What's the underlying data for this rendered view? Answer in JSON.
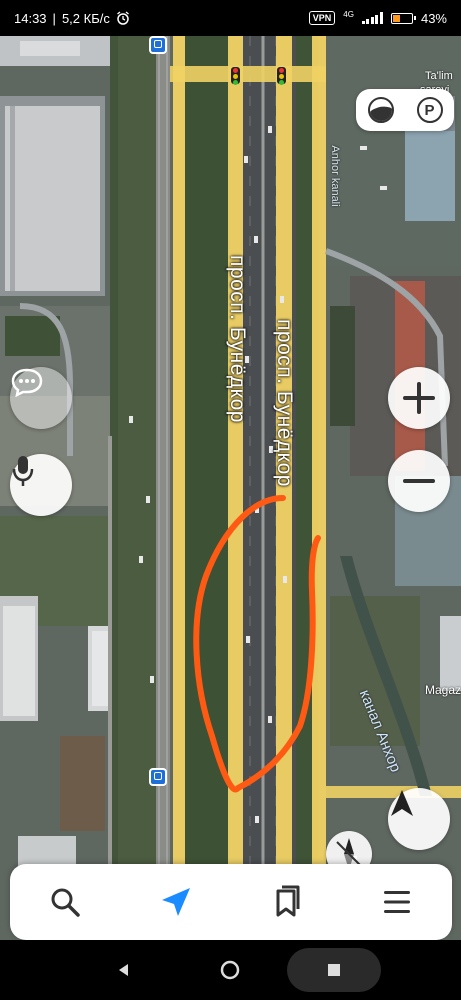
{
  "status_bar": {
    "time": "14:33",
    "network_speed": "5,2 КБ/с",
    "vpn": "VPN",
    "network_type": "4G",
    "battery": "43%",
    "battery_fraction": 0.43
  },
  "map": {
    "street_labels": [
      "просп. Бунёдкор",
      "просп. Бунёдкор"
    ],
    "canal_label": "канал Анхор",
    "canal_label_uz": "Anhor kanali",
    "shop_label": "Magaz",
    "poi_label": "saroyi",
    "poi_label_top": "Ta'lim",
    "annotation_color": "#ff5a14",
    "road_color": "#f0d264",
    "transit_color": "#1f6fd8"
  },
  "controls": {
    "layers": "layers-icon",
    "parking": "P",
    "zoom_in": "plus-icon",
    "zoom_out": "minus-icon",
    "voice": "microphone-icon",
    "chat": "chat-icon",
    "compass": "compass-icon",
    "location": "location-arrow-icon"
  },
  "bottom_nav": {
    "items": [
      {
        "icon": "search-icon"
      },
      {
        "icon": "navigation-arrow-icon",
        "active_color": "#1a8cff"
      },
      {
        "icon": "bookmarks-icon"
      },
      {
        "icon": "menu-icon"
      }
    ]
  },
  "system_nav": {
    "items": [
      "back-icon",
      "home-icon",
      "recents-icon"
    ]
  }
}
